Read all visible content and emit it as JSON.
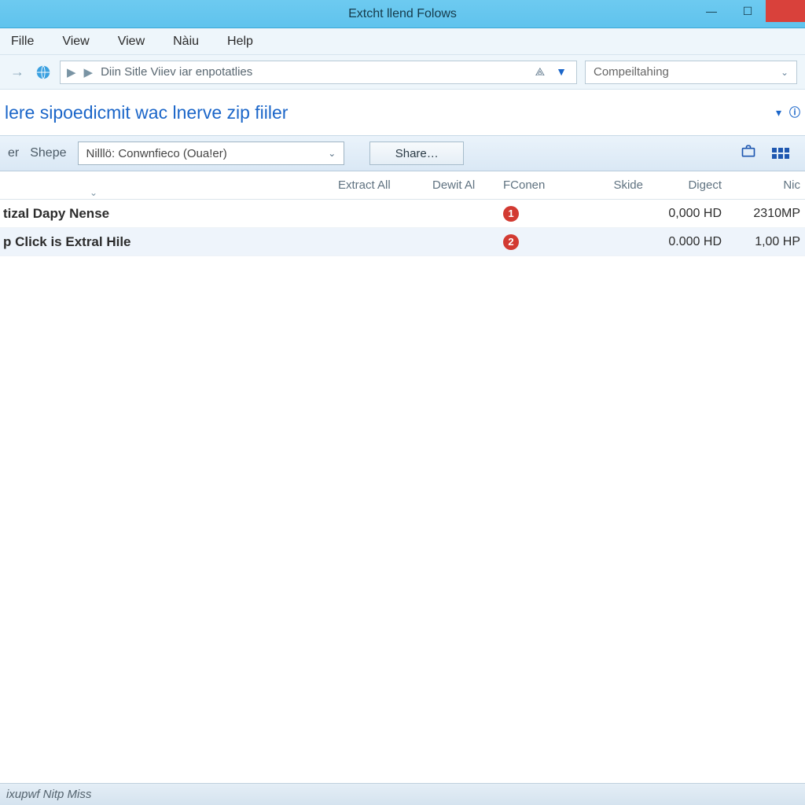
{
  "window": {
    "title": "Extcht llend Folows"
  },
  "menu": {
    "items": [
      "Fille",
      "View",
      "View",
      "Nàiu",
      "Help"
    ]
  },
  "nav": {
    "breadcrumb": "Diin Sitle Viiev iar enpotatlies"
  },
  "search": {
    "placeholder": "Compeiltahing"
  },
  "heading": {
    "text": "lere sipoedicmit wac lnerve zip fiiler"
  },
  "toolbar": {
    "label1": "er",
    "label2": "Shepe",
    "combo_value": "Nilllö: Conwnfieco (Oua!er)",
    "share_label": "Share…"
  },
  "columns": {
    "name": "",
    "extract": "Extract All",
    "dewit": "Dewit Al",
    "conen": "FConen",
    "skide": "Skide",
    "digect": "Digect",
    "nic": "Nic"
  },
  "rows": [
    {
      "name": "tizal Dapy Nense",
      "conen_badge": "1",
      "digect": "0,000 HD",
      "nic": "2310MP"
    },
    {
      "name": "p Click is Extral Hile",
      "conen_badge": "2",
      "digect": "0.000 HD",
      "nic": "1,00 HP"
    }
  ],
  "status": {
    "text": "ixupwf Nitp Miss"
  }
}
